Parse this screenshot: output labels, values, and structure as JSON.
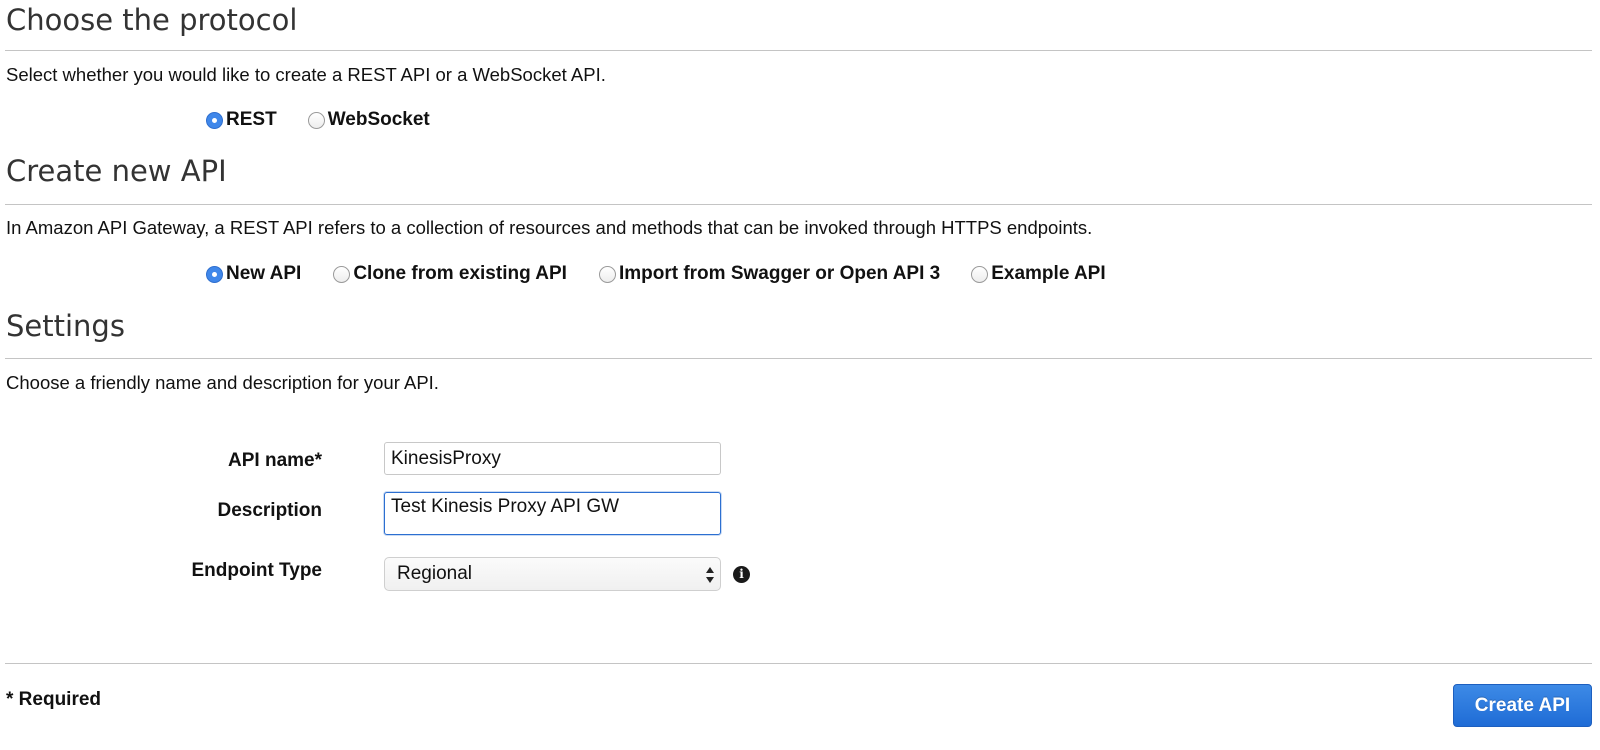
{
  "protocol": {
    "title": "Choose the protocol",
    "description": "Select whether you would like to create a REST API or a WebSocket API.",
    "options": [
      {
        "label": "REST",
        "checked": true
      },
      {
        "label": "WebSocket",
        "checked": false
      }
    ]
  },
  "create_api": {
    "title": "Create new API",
    "description": "In Amazon API Gateway, a REST API refers to a collection of resources and methods that can be invoked through HTTPS endpoints.",
    "options": [
      {
        "label": "New API",
        "checked": true
      },
      {
        "label": "Clone from existing API",
        "checked": false
      },
      {
        "label": "Import from Swagger or Open API 3",
        "checked": false
      },
      {
        "label": "Example API",
        "checked": false
      }
    ]
  },
  "settings": {
    "title": "Settings",
    "description": "Choose a friendly name and description for your API.",
    "api_name_label": "API name*",
    "api_name_value": "KinesisProxy",
    "description_label": "Description",
    "description_value": "Test Kinesis Proxy API GW",
    "endpoint_type_label": "Endpoint Type",
    "endpoint_type_value": "Regional",
    "info_icon": "info-icon"
  },
  "footer": {
    "required_note": "* Required",
    "create_button_label": "Create API"
  },
  "colors": {
    "accent": "#3f87ea",
    "button_bg": "#1f6cd6",
    "focus_border": "#2c6fd1",
    "divider": "#c4c4c4"
  }
}
